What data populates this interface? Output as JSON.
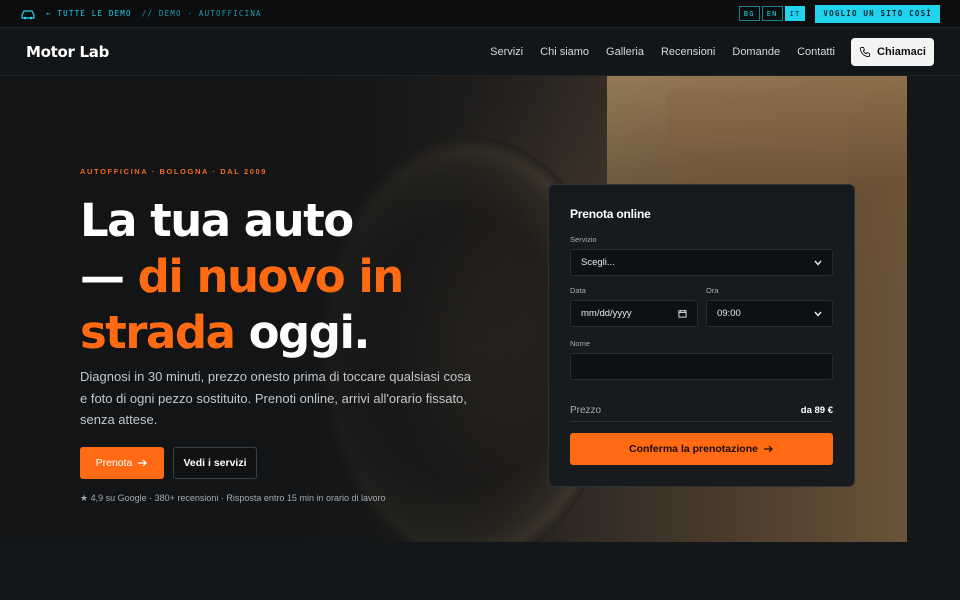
{
  "topbar": {
    "logo_icon": "car-icon",
    "back_link": "← TUTTE LE DEMO",
    "breadcrumb": "// DEMO · AUTOFFICINA",
    "languages": [
      {
        "code": "BG",
        "active": false
      },
      {
        "code": "EN",
        "active": false
      },
      {
        "code": "IT",
        "active": true
      }
    ],
    "cta": "VOGLIO UN SITO COSÌ"
  },
  "nav": {
    "brand": "Motor Lab",
    "links": [
      "Servizi",
      "Chi siamo",
      "Galleria",
      "Recensioni",
      "Domande",
      "Contatti"
    ],
    "call_button": "Chiamaci",
    "call_icon": "phone-icon"
  },
  "hero": {
    "eyebrow": "AUTOFFICINA · BOLOGNA · DAL 2009",
    "headline": {
      "line1": "La tua auto",
      "line2_prefix": "— ",
      "line2_accent": "di nuovo in",
      "line3_accent": "strada",
      "line3_rest": " oggi."
    },
    "lead": "Diagnosi in 30 minuti, prezzo onesto prima di toccare qualsiasi cosa e foto di ogni pezzo sostituito. Prenoti online, arrivi all'orario fissato, senza attese.",
    "primary_button": "Prenota",
    "secondary_button": "Vedi i servizi",
    "rating": "★ 4,9 su Google · 380+ recensioni · Risposta entro 15 min in orario di lavoro"
  },
  "booking": {
    "title": "Prenota online",
    "service_label": "Servizio",
    "service_value": "Scegli...",
    "date_label": "Data",
    "date_placeholder": "mm/dd/yyyy",
    "time_label": "Ora",
    "time_value": "09:00",
    "name_label": "Nome",
    "name_value": "",
    "price_label": "Prezzo",
    "price_value": "da 89 €",
    "confirm_button": "Conferma la prenotazione"
  },
  "colors": {
    "accent": "#ff6a13",
    "cyan": "#22d3ee",
    "background": "#141719"
  }
}
